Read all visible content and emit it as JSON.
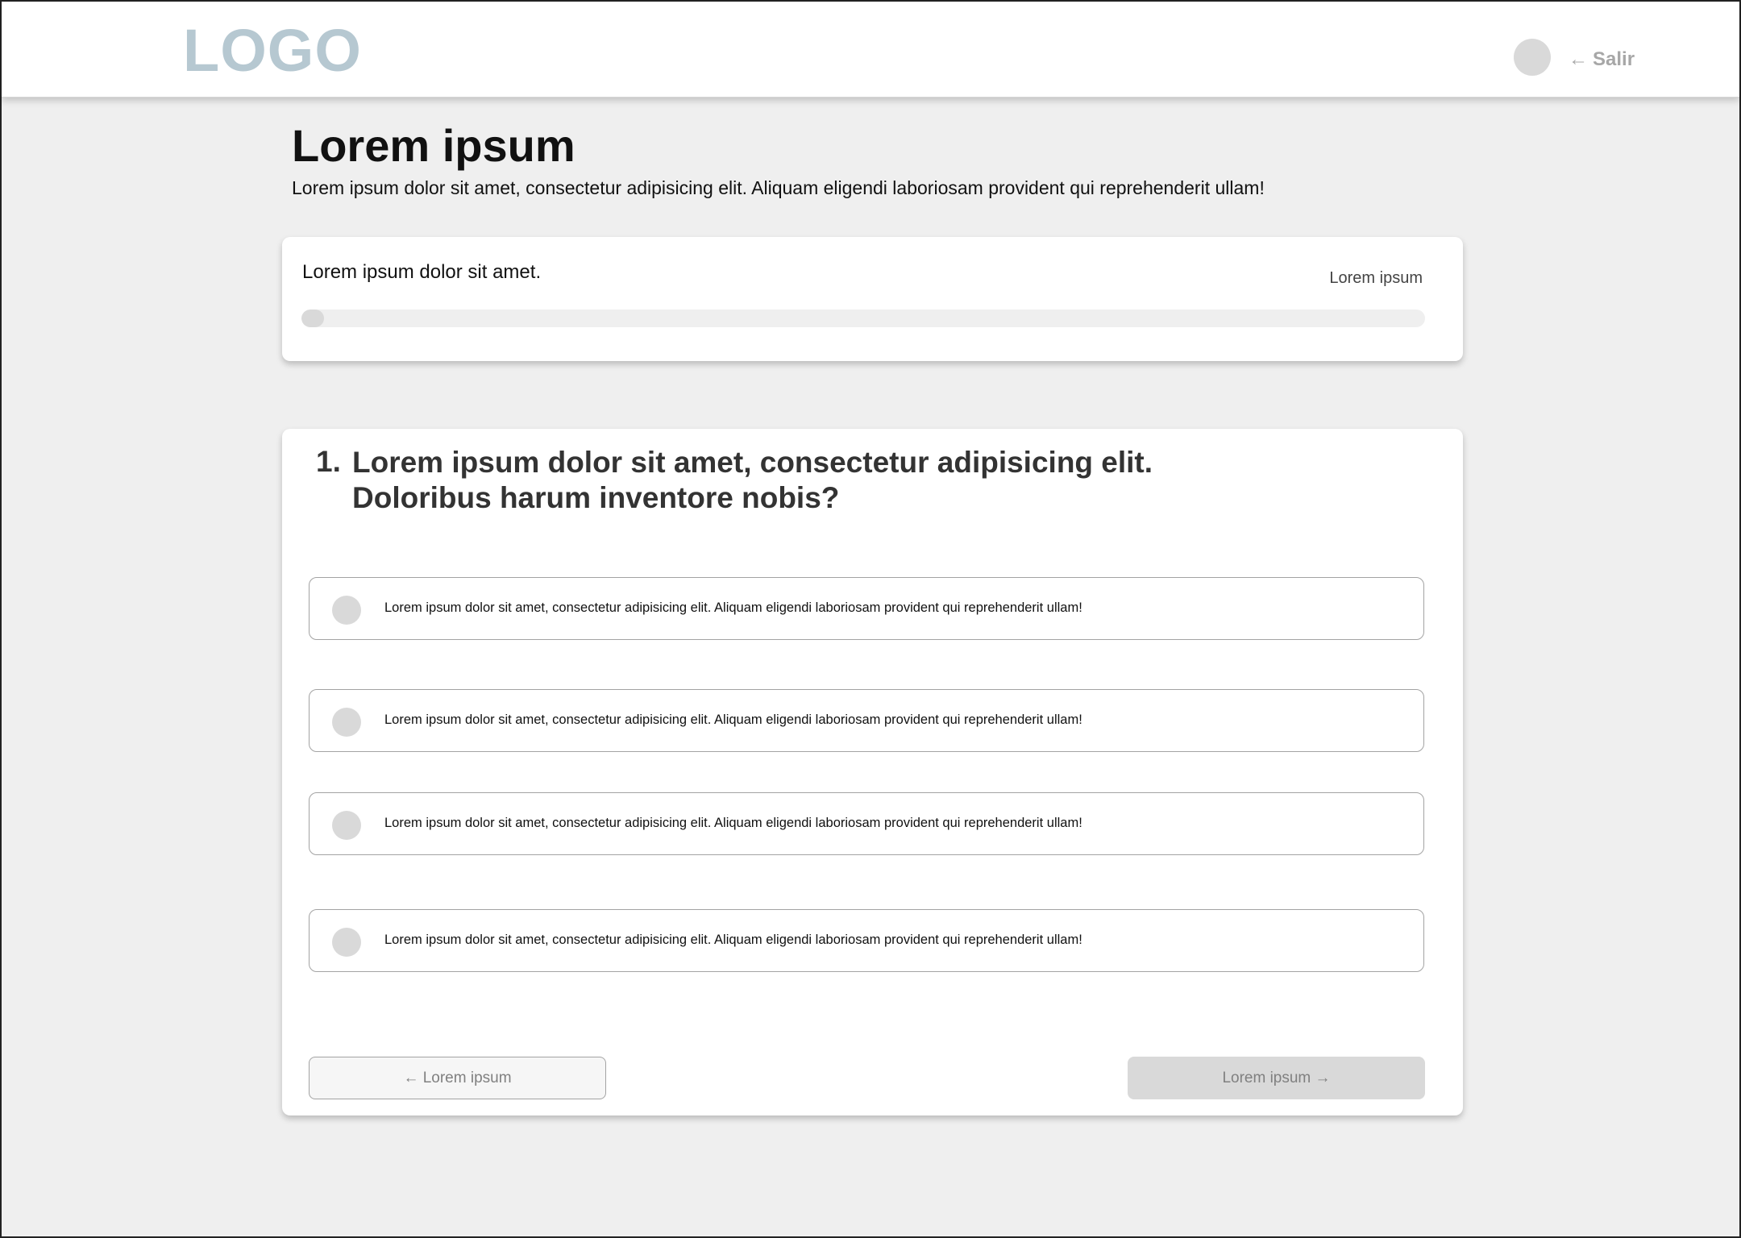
{
  "header": {
    "logo_text": "LOGO",
    "logout_arrow": "←",
    "logout_label": "Salir"
  },
  "page": {
    "title": "Lorem ipsum",
    "subtitle": "Lorem ipsum dolor sit amet, consectetur adipisicing elit. Aliquam eligendi laboriosam provident qui reprehenderit ullam!"
  },
  "progress": {
    "title": "Lorem ipsum dolor sit amet.",
    "status": "Lorem ipsum",
    "value_percent": 2
  },
  "question": {
    "number": "1.",
    "text_line1": "Lorem ipsum dolor sit amet, consectetur adipisicing elit.",
    "text_line2": "Doloribus harum inventore nobis?",
    "options": [
      {
        "label": "Lorem ipsum dolor sit amet, consectetur adipisicing elit. Aliquam eligendi laboriosam provident qui reprehenderit ullam!"
      },
      {
        "label": "Lorem ipsum dolor sit amet, consectetur adipisicing elit. Aliquam eligendi laboriosam provident qui reprehenderit ullam!"
      },
      {
        "label": "Lorem ipsum dolor sit amet, consectetur adipisicing elit. Aliquam eligendi laboriosam provident qui reprehenderit ullam!"
      },
      {
        "label": "Lorem ipsum dolor sit amet, consectetur adipisicing elit. Aliquam eligendi laboriosam provident qui reprehenderit ullam!"
      }
    ]
  },
  "navigation": {
    "prev_label": "← Lorem ipsum",
    "next_label": "Lorem ipsum →"
  },
  "colors": {
    "logo": "#b6c8d1",
    "background": "#efefef",
    "placeholder_gray": "#d9d9d9"
  }
}
